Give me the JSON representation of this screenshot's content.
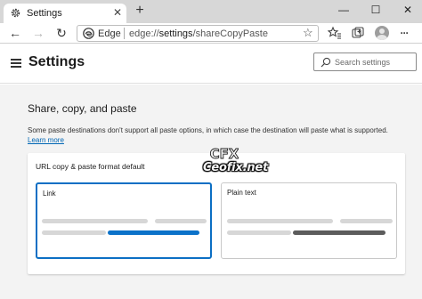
{
  "tab": {
    "title": "Settings",
    "close_glyph": "✕",
    "icon": "gear-icon"
  },
  "window": {
    "new_tab_glyph": "+",
    "minimize_glyph": "—",
    "maximize_glyph": "☐",
    "close_glyph": "✕"
  },
  "toolbar": {
    "back_glyph": "←",
    "forward_glyph": "→",
    "refresh_glyph": "↻",
    "site_label": "Edge",
    "url_prefix": "edge://",
    "url_bold": "settings",
    "url_suffix": "/shareCopyPaste",
    "favorite_glyph": "☆",
    "icons": [
      "star-icon",
      "favorites-icon",
      "collections-icon",
      "profile-icon",
      "more-icon"
    ],
    "more_glyph": "···"
  },
  "header": {
    "title": "Settings",
    "search_placeholder": "Search settings"
  },
  "section": {
    "title": "Share, copy, and paste",
    "description": "Some paste destinations don't support all paste options, in which case the destination will paste what is supported.",
    "learn_more": "Learn more"
  },
  "card": {
    "title": "URL copy & paste format default",
    "options": [
      {
        "label": "Link",
        "selected": true
      },
      {
        "label": "Plain text",
        "selected": false
      }
    ]
  },
  "watermark": {
    "logo_text": "CFX",
    "text": "Ceofix.net"
  },
  "colors": {
    "accent": "#0b72c9",
    "link": "#0066b4",
    "content_bg": "#f3f3f3",
    "tabbar_bg": "#d7d7d7"
  }
}
